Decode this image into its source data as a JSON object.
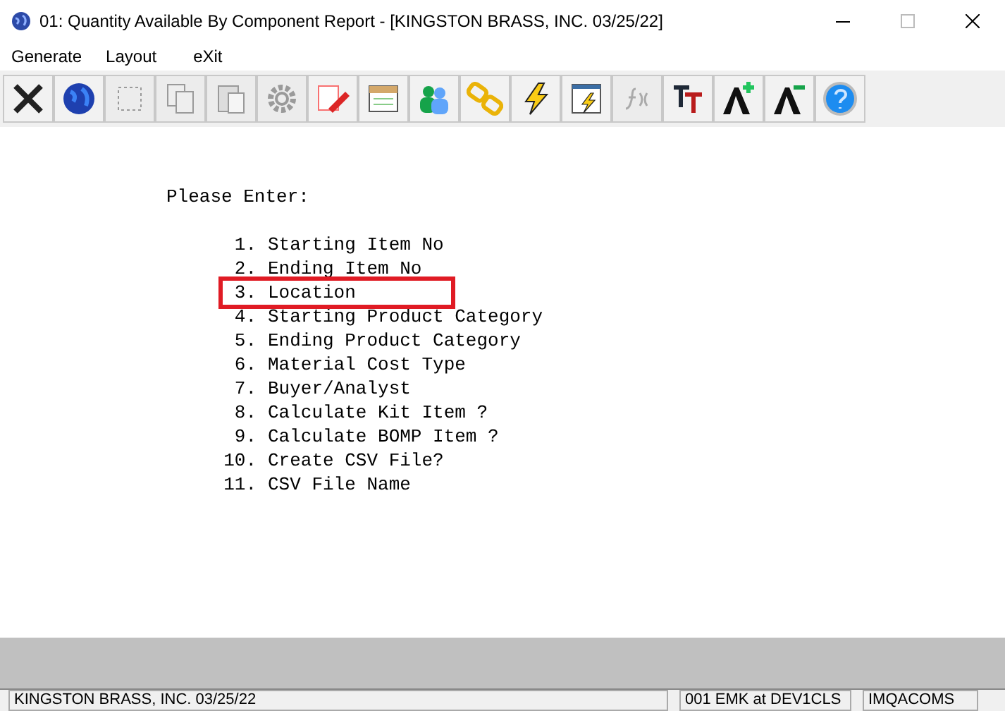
{
  "window": {
    "title": "01: Quantity Available By Component Report - [KINGSTON BRASS, INC. 03/25/22]"
  },
  "menu": [
    {
      "label": "Generate"
    },
    {
      "label": "Layout"
    },
    {
      "label": "eXit"
    }
  ],
  "toolbar": [
    {
      "kind": "close",
      "disabled": false
    },
    {
      "kind": "globe",
      "disabled": false
    },
    {
      "kind": "select",
      "disabled": true
    },
    {
      "kind": "copy",
      "disabled": true
    },
    {
      "kind": "paste",
      "disabled": true
    },
    {
      "kind": "gear",
      "disabled": true
    },
    {
      "kind": "edit",
      "disabled": false
    },
    {
      "kind": "notes",
      "disabled": false
    },
    {
      "kind": "users",
      "disabled": false
    },
    {
      "kind": "link",
      "disabled": false
    },
    {
      "kind": "bolt",
      "disabled": false
    },
    {
      "kind": "run",
      "disabled": false
    },
    {
      "kind": "function",
      "disabled": true
    },
    {
      "kind": "font",
      "disabled": false
    },
    {
      "kind": "grow",
      "disabled": false
    },
    {
      "kind": "shrink",
      "disabled": false
    },
    {
      "kind": "help",
      "disabled": false
    }
  ],
  "prompt": "Please Enter:",
  "fields": [
    {
      "number": "1.",
      "label": "Starting Item No",
      "highlighted": false
    },
    {
      "number": "2.",
      "label": "Ending Item No",
      "highlighted": false
    },
    {
      "number": "3.",
      "label": "Location",
      "highlighted": true
    },
    {
      "number": "4.",
      "label": "Starting Product Category",
      "highlighted": false
    },
    {
      "number": "5.",
      "label": "Ending Product Category",
      "highlighted": false
    },
    {
      "number": "6.",
      "label": "Material Cost Type",
      "highlighted": false
    },
    {
      "number": "7.",
      "label": "Buyer/Analyst",
      "highlighted": false
    },
    {
      "number": "8.",
      "label": "Calculate Kit Item ?",
      "highlighted": false
    },
    {
      "number": "9.",
      "label": "Calculate BOMP Item ?",
      "highlighted": false
    },
    {
      "number": "10.",
      "label": "Create CSV File?",
      "highlighted": false
    },
    {
      "number": "11.",
      "label": "CSV File Name",
      "highlighted": false
    }
  ],
  "status_bar": {
    "company": "KINGSTON BRASS, INC. 03/25/22",
    "user": "001 EMK at DEV1CLS",
    "program": "IMQACOMS"
  }
}
